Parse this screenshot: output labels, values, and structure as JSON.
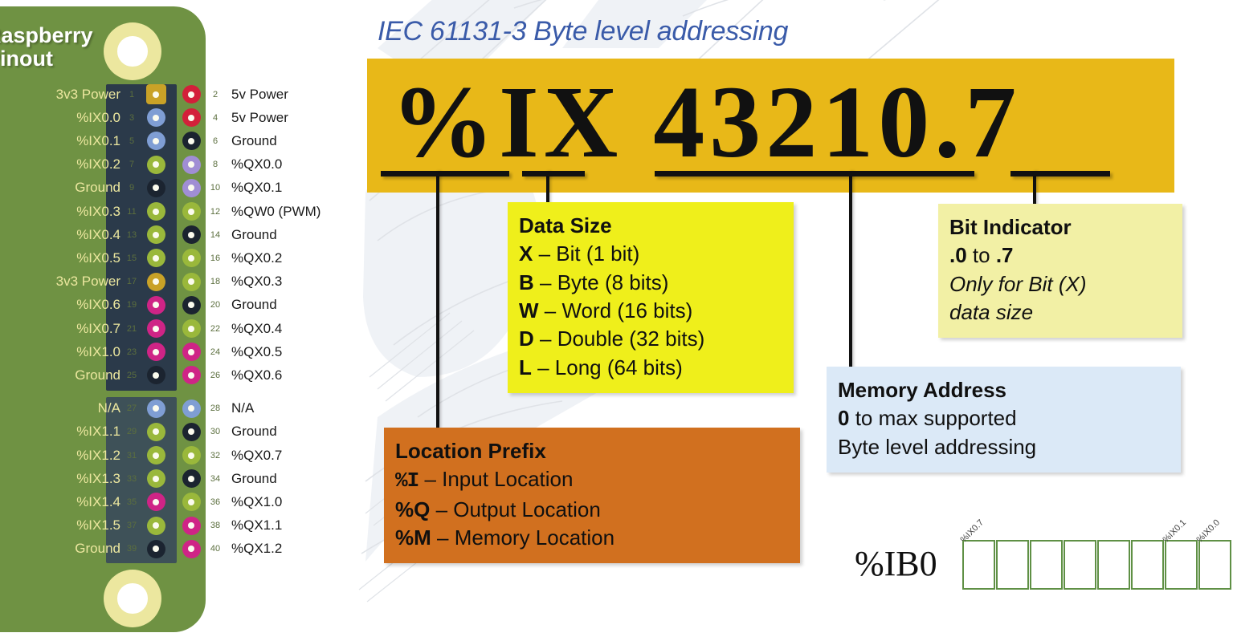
{
  "colors": {
    "board_green": "#6f9243",
    "header_dark": "#2b3a4a",
    "header_dark2": "#3e5158",
    "banner_yellow": "#e8b818",
    "datasize_yellow": "#efef1b",
    "bitind_yellow": "#f2f0a5",
    "memaddr_blue": "#dbe9f7",
    "locprefix_orange": "#d1701f",
    "title_blue": "#3a5ba9",
    "grid_green": "#5f9045",
    "pin_3v3": "#c9a227",
    "pin_5v": "#d3203a",
    "pin_ground": "#1b2430",
    "pin_gpio": "#9ab83b",
    "pin_i2c": "#7f9ed4",
    "pin_uart": "#a08ed4",
    "pin_spi": "#cf2486"
  },
  "board": {
    "title": "Raspberry\nPinout",
    "pins": [
      {
        "num_l": "1",
        "label_l": "3v3 Power",
        "color_l": "#c9a227",
        "shape_l": "square",
        "num_r": "2",
        "label_r": "5v Power",
        "color_r": "#d3203a"
      },
      {
        "num_l": "3",
        "label_l": "%IX0.0",
        "color_l": "#7f9ed4",
        "shape_l": "circle",
        "num_r": "4",
        "label_r": "5v Power",
        "color_r": "#d3203a"
      },
      {
        "num_l": "5",
        "label_l": "%IX0.1",
        "color_l": "#7f9ed4",
        "shape_l": "circle",
        "num_r": "6",
        "label_r": "Ground",
        "color_r": "#1b2430"
      },
      {
        "num_l": "7",
        "label_l": "%IX0.2",
        "color_l": "#9ab83b",
        "shape_l": "circle",
        "num_r": "8",
        "label_r": "%QX0.0",
        "color_r": "#a08ed4"
      },
      {
        "num_l": "9",
        "label_l": "Ground",
        "color_l": "#1b2430",
        "shape_l": "circle",
        "num_r": "10",
        "label_r": "%QX0.1",
        "color_r": "#a08ed4"
      },
      {
        "num_l": "11",
        "label_l": "%IX0.3",
        "color_l": "#9ab83b",
        "shape_l": "circle",
        "num_r": "12",
        "label_r": "%QW0 (PWM)",
        "color_r": "#9ab83b"
      },
      {
        "num_l": "13",
        "label_l": "%IX0.4",
        "color_l": "#9ab83b",
        "shape_l": "circle",
        "num_r": "14",
        "label_r": "Ground",
        "color_r": "#1b2430"
      },
      {
        "num_l": "15",
        "label_l": "%IX0.5",
        "color_l": "#9ab83b",
        "shape_l": "circle",
        "num_r": "16",
        "label_r": "%QX0.2",
        "color_r": "#9ab83b"
      },
      {
        "num_l": "17",
        "label_l": "3v3 Power",
        "color_l": "#c9a227",
        "shape_l": "circle",
        "num_r": "18",
        "label_r": "%QX0.3",
        "color_r": "#9ab83b"
      },
      {
        "num_l": "19",
        "label_l": "%IX0.6",
        "color_l": "#cf2486",
        "shape_l": "circle",
        "num_r": "20",
        "label_r": "Ground",
        "color_r": "#1b2430"
      },
      {
        "num_l": "21",
        "label_l": "%IX0.7",
        "color_l": "#cf2486",
        "shape_l": "circle",
        "num_r": "22",
        "label_r": "%QX0.4",
        "color_r": "#9ab83b"
      },
      {
        "num_l": "23",
        "label_l": "%IX1.0",
        "color_l": "#cf2486",
        "shape_l": "circle",
        "num_r": "24",
        "label_r": "%QX0.5",
        "color_r": "#cf2486"
      },
      {
        "num_l": "25",
        "label_l": "Ground",
        "color_l": "#1b2430",
        "shape_l": "circle",
        "num_r": "26",
        "label_r": "%QX0.6",
        "color_r": "#cf2486"
      },
      {
        "num_l": "27",
        "label_l": "N/A",
        "color_l": "#7f9ed4",
        "shape_l": "circle",
        "num_r": "28",
        "label_r": "N/A",
        "color_r": "#7f9ed4"
      },
      {
        "num_l": "29",
        "label_l": "%IX1.1",
        "color_l": "#9ab83b",
        "shape_l": "circle",
        "num_r": "30",
        "label_r": "Ground",
        "color_r": "#1b2430"
      },
      {
        "num_l": "31",
        "label_l": "%IX1.2",
        "color_l": "#9ab83b",
        "shape_l": "circle",
        "num_r": "32",
        "label_r": "%QX0.7",
        "color_r": "#9ab83b"
      },
      {
        "num_l": "33",
        "label_l": "%IX1.3",
        "color_l": "#9ab83b",
        "shape_l": "circle",
        "num_r": "34",
        "label_r": "Ground",
        "color_r": "#1b2430"
      },
      {
        "num_l": "35",
        "label_l": "%IX1.4",
        "color_l": "#cf2486",
        "shape_l": "circle",
        "num_r": "36",
        "label_r": "%QX1.0",
        "color_r": "#9ab83b"
      },
      {
        "num_l": "37",
        "label_l": "%IX1.5",
        "color_l": "#9ab83b",
        "shape_l": "circle",
        "num_r": "38",
        "label_r": "%QX1.1",
        "color_r": "#cf2486"
      },
      {
        "num_l": "39",
        "label_l": "Ground",
        "color_l": "#1b2430",
        "shape_l": "circle",
        "num_r": "40",
        "label_r": "%QX1.2",
        "color_r": "#cf2486"
      }
    ]
  },
  "slide": {
    "title": "IEC 61131-3 Byte level addressing",
    "banner_text": "%IX 43210.7"
  },
  "callouts": {
    "data_size": {
      "title": "Data Size",
      "lines": [
        {
          "key": "X",
          "rest": " – Bit (1 bit)"
        },
        {
          "key": "B",
          "rest": " – Byte (8 bits)"
        },
        {
          "key": "W",
          "rest": " – Word (16 bits)"
        },
        {
          "key": "D",
          "rest": " – Double (32 bits)"
        },
        {
          "key": "L",
          "rest": " – Long (64 bits)"
        }
      ]
    },
    "bit_indicator": {
      "title": "Bit Indicator",
      "range_prefix": ".0",
      "range_mid": " to ",
      "range_suffix": ".7",
      "note_line1": "Only for Bit (X)",
      "note_line2": "data size"
    },
    "memory_address": {
      "title": "Memory Address",
      "line1_bold": "0",
      "line1_rest": " to max supported",
      "line2": "Byte level addressing"
    },
    "location_prefix": {
      "title": "Location Prefix",
      "lines": [
        {
          "key": "%I",
          "rest": " – Input Location"
        },
        {
          "key": "%Q",
          "rest": " – Output Location"
        },
        {
          "key": "%M",
          "rest": " – Memory Location"
        }
      ]
    }
  },
  "byte_diagram": {
    "label": "%IB0",
    "cells": 8,
    "bit_labels": [
      {
        "index": 0,
        "text": "%IX0.7"
      },
      {
        "index": 6,
        "text": "%IX0.1"
      },
      {
        "index": 7,
        "text": "%IX0.0"
      }
    ]
  }
}
